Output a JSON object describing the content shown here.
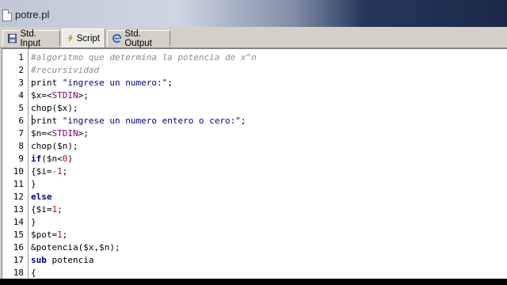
{
  "window": {
    "title": "potre.pl"
  },
  "tabs": [
    {
      "label": "Std. Input",
      "icon": "save-icon",
      "active": false
    },
    {
      "label": "Script",
      "icon": "lightning-icon",
      "active": true
    },
    {
      "label": "Std. Output",
      "icon": "browser-e-icon",
      "active": false
    }
  ],
  "editor": {
    "lines": [
      {
        "num": "1",
        "segments": [
          {
            "t": "#algoritmo que determina la potencia de x^n",
            "c": "comment"
          }
        ]
      },
      {
        "num": "2",
        "segments": [
          {
            "t": "#recursividad",
            "c": "comment"
          }
        ]
      },
      {
        "num": "3",
        "segments": [
          {
            "t": "print ",
            "c": "plain"
          },
          {
            "t": "\"ingrese un numero:\"",
            "c": "str"
          },
          {
            "t": ";",
            "c": "plain"
          }
        ]
      },
      {
        "num": "4",
        "segments": [
          {
            "t": "$x=<",
            "c": "plain"
          },
          {
            "t": "STDIN",
            "c": "fh"
          },
          {
            "t": ">;",
            "c": "plain"
          }
        ]
      },
      {
        "num": "5",
        "segments": [
          {
            "t": "chop($x);",
            "c": "plain"
          }
        ]
      },
      {
        "num": "6",
        "segments": [
          {
            "t": "print ",
            "c": "plain"
          },
          {
            "t": "\"ingrese un numero entero o cero:\"",
            "c": "str"
          },
          {
            "t": ";",
            "c": "plain"
          }
        ]
      },
      {
        "num": "7",
        "segments": [
          {
            "t": "$n=<",
            "c": "plain"
          },
          {
            "t": "STDIN",
            "c": "fh"
          },
          {
            "t": ">;",
            "c": "plain"
          }
        ]
      },
      {
        "num": "8",
        "segments": [
          {
            "t": "chop($n);",
            "c": "plain"
          }
        ]
      },
      {
        "num": "9",
        "segments": [
          {
            "t": "if",
            "c": "kw"
          },
          {
            "t": "($n<",
            "c": "plain"
          },
          {
            "t": "0",
            "c": "num"
          },
          {
            "t": ")",
            "c": "plain"
          }
        ]
      },
      {
        "num": "10",
        "segments": [
          {
            "t": "{$i=",
            "c": "plain"
          },
          {
            "t": "-1",
            "c": "num"
          },
          {
            "t": ";",
            "c": "plain"
          }
        ]
      },
      {
        "num": "11",
        "segments": [
          {
            "t": "}",
            "c": "plain"
          }
        ]
      },
      {
        "num": "12",
        "segments": [
          {
            "t": "else",
            "c": "kw"
          }
        ]
      },
      {
        "num": "13",
        "segments": [
          {
            "t": "{$i=",
            "c": "plain"
          },
          {
            "t": "1",
            "c": "num"
          },
          {
            "t": ";",
            "c": "plain"
          }
        ]
      },
      {
        "num": "14",
        "segments": [
          {
            "t": "}",
            "c": "plain"
          }
        ]
      },
      {
        "num": "15",
        "segments": [
          {
            "t": "$pot=",
            "c": "plain"
          },
          {
            "t": "1",
            "c": "num"
          },
          {
            "t": ";",
            "c": "plain"
          }
        ]
      },
      {
        "num": "16",
        "segments": [
          {
            "t": "&potencia($x,$n);",
            "c": "plain"
          }
        ]
      },
      {
        "num": "17",
        "segments": [
          {
            "t": "sub ",
            "c": "kw"
          },
          {
            "t": "potencia",
            "c": "plain"
          }
        ]
      },
      {
        "num": "18",
        "segments": [
          {
            "t": "{",
            "c": "plain"
          }
        ]
      }
    ]
  },
  "colors": {
    "comment": "#8c8c8c",
    "keyword": "#00008b",
    "string": "#000080",
    "number": "#d00000",
    "filehandle": "#800080"
  }
}
